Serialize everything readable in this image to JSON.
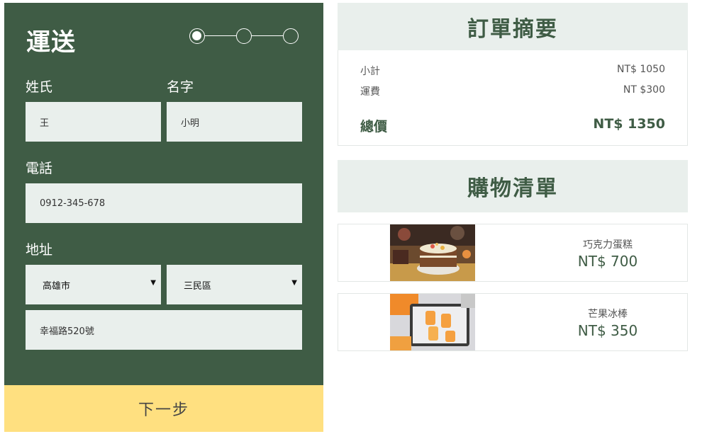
{
  "shipping": {
    "title": "運送",
    "steps": [
      {
        "active": true
      },
      {
        "active": false
      },
      {
        "active": false
      }
    ],
    "last_name": {
      "label": "姓氏",
      "value": "王"
    },
    "first_name": {
      "label": "名字",
      "value": "小明"
    },
    "phone": {
      "label": "電話",
      "value": "0912-345-678"
    },
    "address": {
      "label": "地址",
      "city": "高雄市",
      "district": "三民區",
      "street": "幸福路520號"
    },
    "next_label": "下一步"
  },
  "summary": {
    "title": "訂單摘要",
    "subtotal_label": "小計",
    "subtotal_value": "NT$ 1050",
    "shipping_label": "運費",
    "shipping_value": "NT $300",
    "total_label": "總價",
    "total_value": "NT$ 1350"
  },
  "cart": {
    "title": "購物清單",
    "items": [
      {
        "name": "巧克力蛋糕",
        "price": "NT$ 700"
      },
      {
        "name": "芒果冰棒",
        "price": "NT$ 350"
      }
    ]
  },
  "colors": {
    "panel_green": "#3f5c45",
    "input_bg": "#e9efec",
    "button_yellow": "#ffe080"
  }
}
